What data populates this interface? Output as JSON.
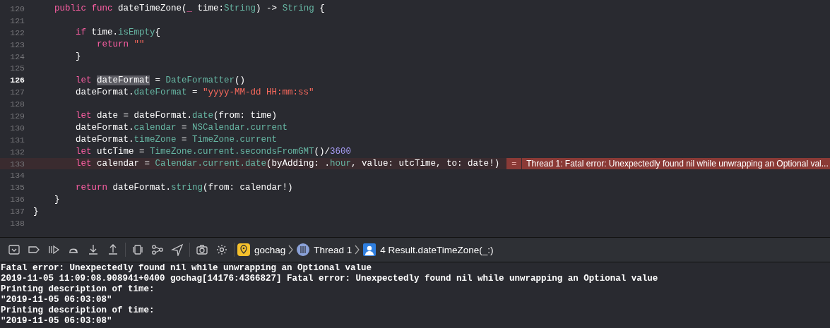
{
  "editor": {
    "lines": [
      {
        "number": "120",
        "current": false,
        "error": false,
        "tokens": [
          {
            "kind": "keyword",
            "text": "    public func"
          },
          {
            "kind": "plain",
            "text": " dateTimeZone("
          },
          {
            "kind": "keyword",
            "text": "_"
          },
          {
            "kind": "plain",
            "text": " time:"
          },
          {
            "kind": "type",
            "text": "String"
          },
          {
            "kind": "plain",
            "text": ") -> "
          },
          {
            "kind": "type",
            "text": "String"
          },
          {
            "kind": "plain",
            "text": " {"
          }
        ]
      },
      {
        "number": "121",
        "current": false,
        "error": false
      },
      {
        "number": "122",
        "current": false,
        "error": false,
        "tokens": [
          {
            "kind": "keyword",
            "text": "        if"
          },
          {
            "kind": "plain",
            "text": " time."
          },
          {
            "kind": "type",
            "text": "isEmpty"
          },
          {
            "kind": "plain",
            "text": "{"
          }
        ]
      },
      {
        "number": "123",
        "current": false,
        "error": false,
        "tokens": [
          {
            "kind": "keyword",
            "text": "            return "
          },
          {
            "kind": "string",
            "text": "\"\""
          }
        ]
      },
      {
        "number": "124",
        "current": false,
        "error": false,
        "tokens": [
          {
            "kind": "plain",
            "text": "        }"
          }
        ]
      },
      {
        "number": "125",
        "current": false,
        "error": false
      },
      {
        "number": "126",
        "current": true,
        "error": false,
        "tokens": [
          {
            "kind": "keyword",
            "text": "        let "
          },
          {
            "kind": "plain",
            "text": "dateFormat",
            "highlighted": true
          },
          {
            "kind": "plain",
            "text": " = "
          },
          {
            "kind": "type",
            "text": "DateFormatter"
          },
          {
            "kind": "plain",
            "text": "()"
          }
        ]
      },
      {
        "number": "127",
        "current": false,
        "error": false,
        "tokens": [
          {
            "kind": "plain",
            "text": "        dateFormat."
          },
          {
            "kind": "type",
            "text": "dateFormat"
          },
          {
            "kind": "plain",
            "text": " = "
          },
          {
            "kind": "string",
            "text": "\"yyyy-MM-dd HH:mm:ss\""
          }
        ]
      },
      {
        "number": "128",
        "current": false,
        "error": false
      },
      {
        "number": "129",
        "current": false,
        "error": false,
        "tokens": [
          {
            "kind": "keyword",
            "text": "        let"
          },
          {
            "kind": "plain",
            "text": " date = dateFormat."
          },
          {
            "kind": "type",
            "text": "date"
          },
          {
            "kind": "plain",
            "text": "(from: time)"
          }
        ]
      },
      {
        "number": "130",
        "current": false,
        "error": false,
        "tokens": [
          {
            "kind": "plain",
            "text": "        dateFormat."
          },
          {
            "kind": "type",
            "text": "calendar"
          },
          {
            "kind": "plain",
            "text": " = "
          },
          {
            "kind": "type",
            "text": "NSCalendar.current"
          }
        ]
      },
      {
        "number": "131",
        "current": false,
        "error": false,
        "tokens": [
          {
            "kind": "plain",
            "text": "        dateFormat."
          },
          {
            "kind": "type",
            "text": "timeZone"
          },
          {
            "kind": "plain",
            "text": " = "
          },
          {
            "kind": "type",
            "text": "TimeZone.current"
          }
        ]
      },
      {
        "number": "132",
        "current": false,
        "error": false,
        "tokens": [
          {
            "kind": "keyword",
            "text": "        let"
          },
          {
            "kind": "plain",
            "text": " utcTime = "
          },
          {
            "kind": "type",
            "text": "TimeZone.current.secondsFromGMT"
          },
          {
            "kind": "plain",
            "text": "()/"
          },
          {
            "kind": "number",
            "text": "3600"
          }
        ]
      },
      {
        "number": "133",
        "current": false,
        "error": true,
        "tokens": [
          {
            "kind": "keyword",
            "text": "        let"
          },
          {
            "kind": "plain",
            "text": " calendar = "
          },
          {
            "kind": "type",
            "text": "Calendar.current.date"
          },
          {
            "kind": "plain",
            "text": "(byAdding: ."
          },
          {
            "kind": "type",
            "text": "hour"
          },
          {
            "kind": "plain",
            "text": ", value: utcTime, to: date!)"
          }
        ],
        "error_marker": "=",
        "error_message": "Thread 1: Fatal error: Unexpectedly found nil while unwrapping an Optional val..."
      },
      {
        "number": "134",
        "current": false,
        "error": false
      },
      {
        "number": "135",
        "current": false,
        "error": false,
        "tokens": [
          {
            "kind": "keyword",
            "text": "        return"
          },
          {
            "kind": "plain",
            "text": " dateFormat."
          },
          {
            "kind": "type",
            "text": "string"
          },
          {
            "kind": "plain",
            "text": "(from: calendar!)"
          }
        ]
      },
      {
        "number": "136",
        "current": false,
        "error": false,
        "tokens": [
          {
            "kind": "plain",
            "text": "    }"
          }
        ]
      },
      {
        "number": "137",
        "current": false,
        "error": false,
        "tokens": [
          {
            "kind": "plain",
            "text": "}"
          }
        ]
      },
      {
        "number": "138",
        "current": false,
        "error": false
      }
    ]
  },
  "debug_bar": {
    "breadcrumbs": [
      {
        "kind": "app",
        "label": "gochag"
      },
      {
        "kind": "thread",
        "label": "Thread 1"
      },
      {
        "kind": "frame",
        "label": "4 Result.dateTimeZone(_:)"
      }
    ]
  },
  "console": {
    "lines": [
      "Fatal error: Unexpectedly found nil while unwrapping an Optional value",
      "2019-11-05 11:09:08.908941+0400 gochag[14176:4366827] Fatal error: Unexpectedly found nil while unwrapping an Optional value",
      "Printing description of time:",
      "\"2019-11-05 06:03:08\"",
      "Printing description of time:",
      "\"2019-11-05 06:03:08\""
    ]
  }
}
